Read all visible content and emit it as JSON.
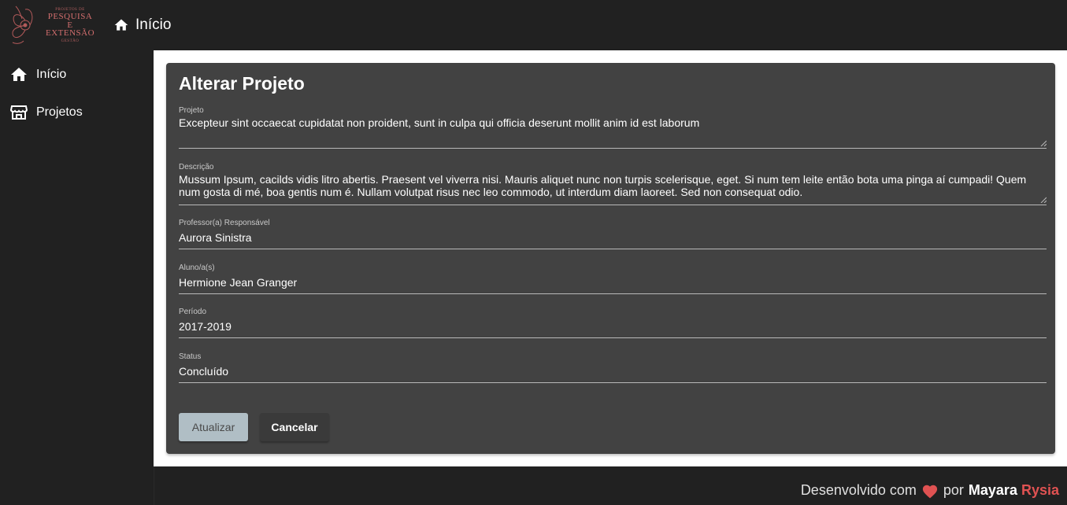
{
  "app": {
    "logo": {
      "line1": "PROJETOS DE",
      "line2": "PESQUISA",
      "line3": "E",
      "line4": "EXTENSÃO",
      "line5": "GESTÃO"
    },
    "topbar": {
      "home_label": "Início"
    }
  },
  "sidebar": {
    "items": [
      {
        "label": "Início",
        "icon": "home-icon"
      },
      {
        "label": "Projetos",
        "icon": "store-icon"
      }
    ]
  },
  "form": {
    "title": "Alterar Projeto",
    "fields": [
      {
        "label": "Projeto",
        "value": "Excepteur sint occaecat cupidatat non proident, sunt in culpa qui officia deserunt mollit anim id est laborum"
      },
      {
        "label": "Descrição",
        "value": "Mussum Ipsum, cacilds vidis litro abertis. Praesent vel viverra nisi. Mauris aliquet nunc non turpis scelerisque, eget. Si num tem leite então bota uma pinga aí cumpadi! Quem num gosta di mé, boa gentis num é. Nullam volutpat risus nec leo commodo, ut interdum diam laoreet. Sed non consequat odio."
      },
      {
        "label": "Professor(a) Responsável",
        "value": "Aurora Sinistra"
      },
      {
        "label": "Aluno/a(s)",
        "value": "Hermione Jean Granger"
      },
      {
        "label": "Período",
        "value": "2017-2019"
      },
      {
        "label": "Status",
        "value": "Concluído"
      }
    ],
    "buttons": {
      "update": "Atualizar",
      "cancel": "Cancelar"
    }
  },
  "footer": {
    "text_before": "Desenvolvido com",
    "text_by": "por",
    "author_first": "Mayara",
    "author_last": "Rysia",
    "heart_color": "#e05252"
  },
  "colors": {
    "accent_button": "#b0bec5",
    "card_bg": "#424242",
    "app_bg": "#212121"
  }
}
